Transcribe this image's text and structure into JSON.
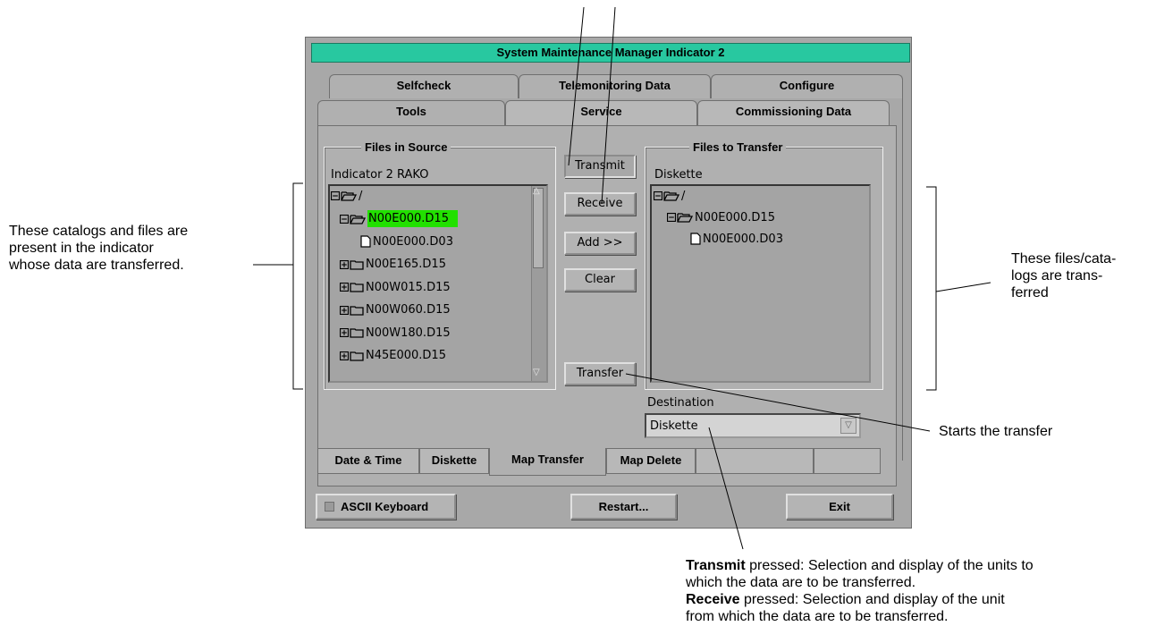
{
  "window": {
    "title": "System Maintenance Manager Indicator 2",
    "accent_color": "#28c8a0",
    "highlight_color": "#22e000"
  },
  "tabs": {
    "row1": [
      "Selfcheck",
      "Telemonitoring Data",
      "Configure"
    ],
    "row2": [
      "Tools",
      "Service",
      "Commissioning Data"
    ]
  },
  "source": {
    "group_title": "Files in Source",
    "label": "Indicator  2 RAKO",
    "tree": [
      {
        "text": "/",
        "icon": "folder-open-icon",
        "expander": "minus"
      },
      {
        "text": "N00E000.D15",
        "icon": "folder-open-icon",
        "expander": "minus",
        "selected": true
      },
      {
        "text": "N00E000.D03",
        "icon": "file-icon",
        "expander": "none"
      },
      {
        "text": "N00E165.D15",
        "icon": "folder-icon",
        "expander": "plus"
      },
      {
        "text": "N00W015.D15",
        "icon": "folder-icon",
        "expander": "plus"
      },
      {
        "text": "N00W060.D15",
        "icon": "folder-icon",
        "expander": "plus"
      },
      {
        "text": "N00W180.D15",
        "icon": "folder-icon",
        "expander": "plus"
      },
      {
        "text": "N45E000.D15",
        "icon": "folder-icon",
        "expander": "plus"
      }
    ]
  },
  "buttons": {
    "transmit": "Transmit",
    "receive": "Receive",
    "add": "Add >>",
    "clear": "Clear",
    "transfer": "Transfer"
  },
  "target": {
    "group_title": "Files to Transfer",
    "label": "Diskette",
    "tree": [
      {
        "text": "/",
        "icon": "folder-open-icon",
        "expander": "minus"
      },
      {
        "text": "N00E000.D15",
        "icon": "folder-open-icon",
        "expander": "minus"
      },
      {
        "text": "N00E000.D03",
        "icon": "file-icon",
        "expander": "none"
      }
    ]
  },
  "destination": {
    "label": "Destination",
    "value": "Diskette"
  },
  "bottom_tabs": [
    "Date & Time",
    "Diskette",
    "Map Transfer",
    "Map Delete"
  ],
  "footer": {
    "ascii_keyboard": "ASCII Keyboard",
    "restart": "Restart...",
    "exit": "Exit"
  },
  "annotations": {
    "left": [
      "These catalogs and files are",
      "present in the indicator",
      "whose data are transferred."
    ],
    "right": [
      "These files/cata-",
      "logs are trans-",
      "ferred"
    ],
    "transfer": "Starts the transfer",
    "bottom_line1_bold": "Transmit",
    "bottom_line1_rest": " pressed: Selection and display of the units to",
    "bottom_line2": "which the data are to be transferred.",
    "bottom_line3_bold": "Receive",
    "bottom_line3_rest": " pressed: Selection and display of the unit",
    "bottom_line4": "from which the data are to be transferred."
  }
}
